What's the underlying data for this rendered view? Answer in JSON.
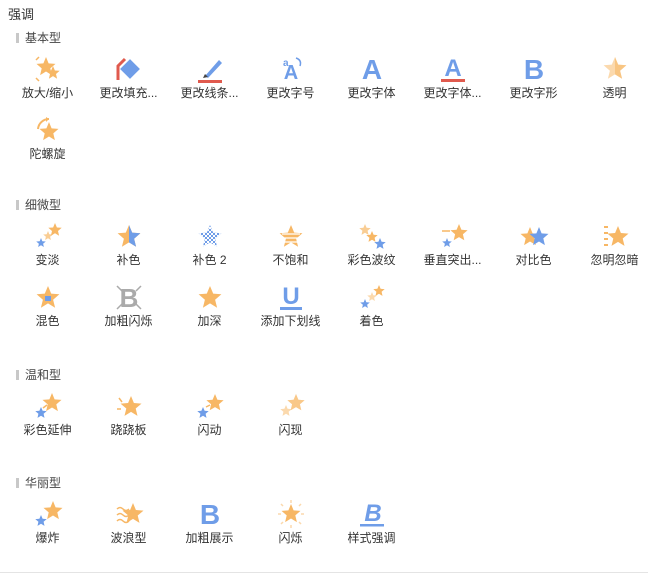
{
  "panel": {
    "title": "强调"
  },
  "colors": {
    "star": "#f7b765",
    "blue": "#6f9de8",
    "red": "#e05a4e",
    "accent_light": "#fbd9ad"
  },
  "sections": [
    {
      "title": "基本型",
      "items": [
        {
          "label": "放大/缩小",
          "icon": "star-grow-icon"
        },
        {
          "label": "更改填充...",
          "icon": "fill-bucket-icon"
        },
        {
          "label": "更改线条...",
          "icon": "pen-line-icon"
        },
        {
          "label": "更改字号",
          "icon": "font-size-icon"
        },
        {
          "label": "更改字体",
          "icon": "font-icon"
        },
        {
          "label": "更改字体...",
          "icon": "font-color-icon"
        },
        {
          "label": "更改字形",
          "icon": "bold-icon"
        },
        {
          "label": "透明",
          "icon": "star-transparent-icon"
        },
        {
          "label": "陀螺旋",
          "icon": "star-spin-icon"
        }
      ]
    },
    {
      "title": "细微型",
      "items": [
        {
          "label": "变淡",
          "icon": "star-fade-icon"
        },
        {
          "label": "补色",
          "icon": "star-complement-icon"
        },
        {
          "label": "补色 2",
          "icon": "star-complement2-icon"
        },
        {
          "label": "不饱和",
          "icon": "star-desaturate-icon"
        },
        {
          "label": "彩色波纹",
          "icon": "star-color-wave-icon"
        },
        {
          "label": "垂直突出...",
          "icon": "star-vertical-icon"
        },
        {
          "label": "对比色",
          "icon": "star-contrast-icon"
        },
        {
          "label": "忽明忽暗",
          "icon": "star-flicker-icon"
        },
        {
          "label": "混色",
          "icon": "star-blend-icon"
        },
        {
          "label": "加粗闪烁",
          "icon": "bold-flash-icon"
        },
        {
          "label": "加深",
          "icon": "star-darken-icon"
        },
        {
          "label": "添加下划线",
          "icon": "underline-icon"
        },
        {
          "label": "着色",
          "icon": "star-tint-icon"
        }
      ]
    },
    {
      "title": "温和型",
      "items": [
        {
          "label": "彩色延伸",
          "icon": "star-color-extend-icon"
        },
        {
          "label": "跷跷板",
          "icon": "star-teeter-icon"
        },
        {
          "label": "闪动",
          "icon": "star-flick-icon"
        },
        {
          "label": "闪现",
          "icon": "star-flash-icon"
        }
      ]
    },
    {
      "title": "华丽型",
      "items": [
        {
          "label": "爆炸",
          "icon": "star-explode-icon"
        },
        {
          "label": "波浪型",
          "icon": "star-wave-icon"
        },
        {
          "label": "加粗展示",
          "icon": "bold-reveal-icon"
        },
        {
          "label": "闪烁",
          "icon": "star-blink-icon"
        },
        {
          "label": "样式强调",
          "icon": "style-emphasis-icon"
        }
      ]
    }
  ]
}
